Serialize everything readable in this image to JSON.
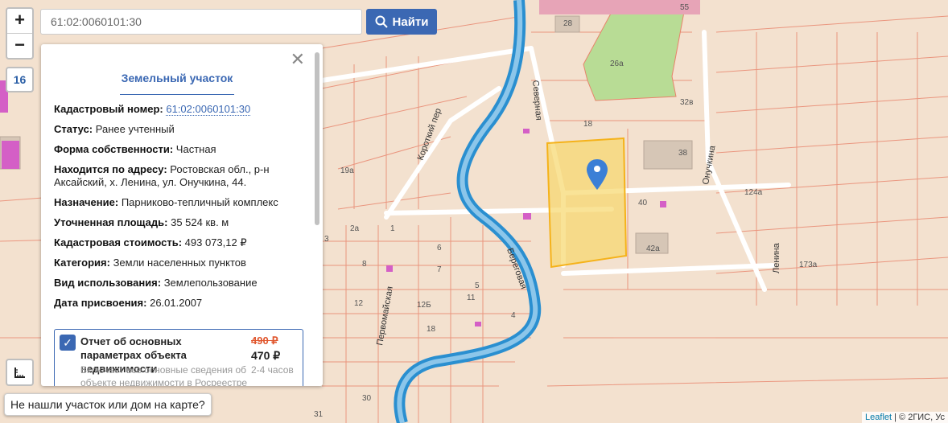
{
  "search": {
    "value": "61:02:0060101:30",
    "button_label": "Найти"
  },
  "zoom": {
    "plus": "+",
    "minus": "−",
    "level": "16"
  },
  "panel": {
    "title": "Земельный участок",
    "fields": [
      {
        "label": "Кадастровый номер:",
        "value": "61:02:0060101:30",
        "link": true
      },
      {
        "label": "Статус:",
        "value": "Ранее учтенный"
      },
      {
        "label": "Форма собственности:",
        "value": "Частная"
      },
      {
        "label": "Находится по адресу:",
        "value": "Ростовская обл., р-н Аксайский, х. Ленина, ул. Онучкина, 44."
      },
      {
        "label": "Назначение:",
        "value": "Парниково-тепличный комплекс"
      },
      {
        "label": "Уточненная площадь:",
        "value": "35 524 кв. м"
      },
      {
        "label": "Кадастровая стоимость:",
        "value": "493 073,12 ₽"
      },
      {
        "label": "Категория:",
        "value": "Земли населенных пунктов"
      },
      {
        "label": "Вид использования:",
        "value": "Землепользование"
      },
      {
        "label": "Дата присвоения:",
        "value": "26.01.2007"
      }
    ],
    "offer": {
      "title": "Отчет об основных параметрах объекта недвижимости",
      "old_price": "490 ₽",
      "new_price": "470 ₽",
      "description": "Включает все основные сведения об объекте недвижимости в Росреестре",
      "time": "2-4 часов"
    }
  },
  "not_found_label": "Не нашли участок или дом на карте?",
  "attribution": {
    "leaflet": "Leaflet",
    "rest": "| © 2ГИС, Ус"
  },
  "map": {
    "streets": [
      "Короткий пер",
      "Северная",
      "Онучкина",
      "Ленина",
      "Береговая",
      "Первомайская"
    ],
    "house_numbers": [
      "28",
      "26а",
      "32в",
      "38",
      "40",
      "42а",
      "124а",
      "173а",
      "18",
      "19а",
      "2а",
      "1",
      "3",
      "8",
      "6",
      "7",
      "5",
      "11",
      "12Б",
      "18",
      "12",
      "30",
      "31",
      "55",
      "4"
    ]
  },
  "colors": {
    "accent": "#3b68b3",
    "parcel": "#f5c842",
    "river": "#2a8fd0",
    "price_old": "#e0562d"
  }
}
